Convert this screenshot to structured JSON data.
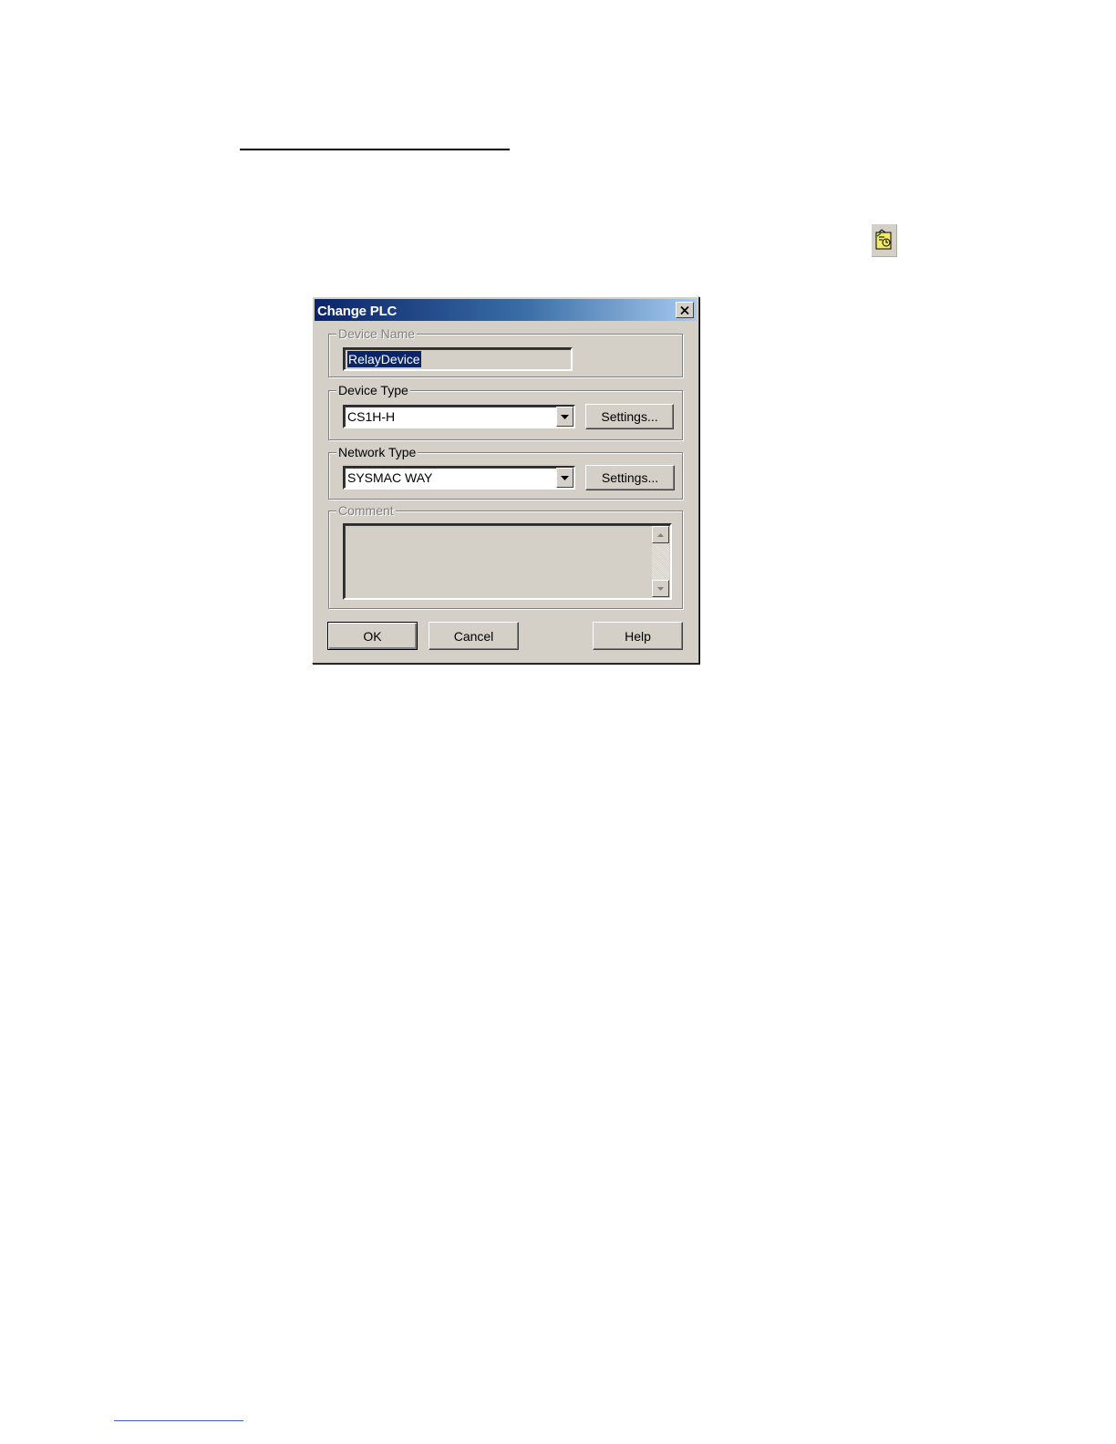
{
  "toolbar": {
    "icon": "change-plc-icon"
  },
  "dialog": {
    "title": "Change PLC",
    "close_icon": "close-icon",
    "device_name": {
      "label": "Device Name",
      "value": "RelayDevice"
    },
    "device_type": {
      "label": "Device Type",
      "value": "CS1H-H",
      "settings_label": "Settings..."
    },
    "network_type": {
      "label": "Network Type",
      "value": "SYSMAC WAY",
      "settings_label": "Settings..."
    },
    "comment": {
      "label": "Comment",
      "value": ""
    },
    "buttons": {
      "ok": "OK",
      "cancel": "Cancel",
      "help": "Help"
    }
  },
  "colors": {
    "dialog_face": "#d4d0c8",
    "title_gradient_start": "#0a246a",
    "title_gradient_end": "#a6caf0",
    "selection": "#0a246a"
  }
}
